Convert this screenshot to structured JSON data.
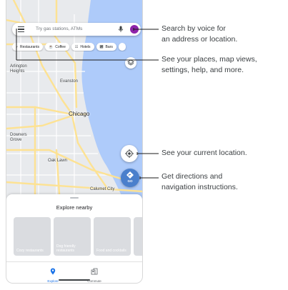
{
  "search": {
    "placeholder": "Try gas stations, ATMs"
  },
  "chips": [
    {
      "label": "Restaurants",
      "icon": "fork-knife-icon",
      "glyph": "⑂"
    },
    {
      "label": "Coffee",
      "icon": "coffee-icon",
      "glyph": "☕"
    },
    {
      "label": "Hotels",
      "icon": "bed-icon",
      "glyph": "☷"
    },
    {
      "label": "Bars",
      "icon": "cocktail-icon",
      "glyph": "␲"
    }
  ],
  "map": {
    "labels": {
      "arlington_line1": "Arlington",
      "arlington_line2": "Heights",
      "evanston": "Evanston",
      "chicago": "Chicago",
      "downers_line1": "Downers",
      "downers_line2": "Grove",
      "oak_lawn": "Oak Lawn",
      "calumet": "Calumet City"
    },
    "colors": {
      "land": "#e8eaed",
      "water": "#aecbfa",
      "highway": "#fde293",
      "road": "#ffffff"
    }
  },
  "go_button": {
    "label": "GO"
  },
  "explore": {
    "title": "Explore nearby",
    "cards": [
      {
        "label": "Cozy restaurants"
      },
      {
        "label": "Dog friendly restaurants"
      },
      {
        "label": "Food and cocktails"
      }
    ]
  },
  "nav": {
    "explore": "Explore",
    "commute": "Commute",
    "active_color": "#1a73e8"
  },
  "callouts": {
    "voice_line1": "Search by voice for",
    "voice_line2": "an address or location.",
    "menu_line1": "See your places, map views,",
    "menu_line2": "settings, help, and more.",
    "location": "See your current location.",
    "directions_line1": "Get directions and",
    "directions_line2": "navigation instructions."
  }
}
